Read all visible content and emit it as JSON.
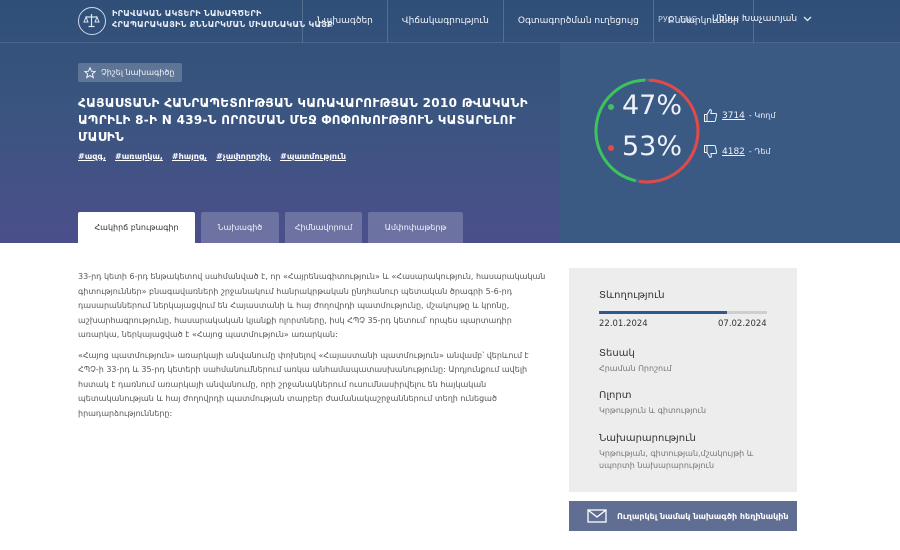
{
  "header": {
    "brand_line1": "ԻՐԱՎԱԿԱՆ ԱԿՏԵՐԻ ՆԱԽԱԳԾԵՐԻ",
    "brand_line2": "ՀՐԱՊԱՐԱԿԱՅԻՆ ՔՆՆԱՐԿՄԱՆ ՄԻԱՍՆԱԿԱՆ ԿԱՅՔ",
    "nav": [
      "Նախագծեր",
      "Վիճակագրություն",
      "Օգտագործման ուղեցույց",
      "Քննարկումներ"
    ],
    "languages": [
      "РУС",
      "ENG"
    ],
    "user_name": "Աննա Խաչատյան"
  },
  "project": {
    "favorite_label": "Չիշել նախագիծը",
    "title": "ՀԱՅԱՍՏԱՆԻ ՀԱՆՐԱՊԵՏՈՒԹՅԱՆ ԿԱՌԱՎԱՐՈՒԹՅԱՆ 2010 ԹՎԱԿԱՆԻ ԱՊՐԻԼԻ 8-Ի N 439-Ն ՈՐՈՇՄԱՆ ՄԵՋ ՓՈՓՈԽՈՒԹՅՈՒՆ ԿԱՏԱՐԵԼՈՒ ՄԱՍԻՆ",
    "tags": [
      "#ազգ,",
      "#առարկա,",
      "#հայոց,",
      "#չափորոշիչ,",
      "#պատմություն"
    ],
    "tabs": [
      "Հակիրճ բնութագիր",
      "Նախագիծ",
      "Հիմնավորում",
      "Ամփոփաթերթ"
    ]
  },
  "votes": {
    "for_percent": "47%",
    "against_percent": "53%",
    "for_fraction": 0.47,
    "for_count": "3714",
    "for_label": "- Կողմ",
    "against_count": "4182",
    "against_label": "- Դեմ",
    "colors": {
      "for": "#3cc45a",
      "against": "#e04a4a"
    }
  },
  "content": {
    "paragraph1": "33-րդ կետի 6-րդ ենթակետով սահմանված է, որ «Հայրենագիտություն» և «Հասարակություն, հասարակական գիտություններ» բնագավառների շրջանակում հանրակրթական ընդհանուր պետական ծրագրի 5-6-րդ դասարաններում ներկայացվում են Հայաստանի և հայ ժողովրդի պատմությունը, մշակույթը և կրոնը, աշխարհագրությունը, հասարակական կյանքի ոլորտները, իսկ ՀՊՉ 35-րդ կետում՝ որպես պարտադիր առարկա, ներկայացված է «Հայոց պատմություն» առարկան:",
    "paragraph2": "«Հայոց պատմություն» առարկայի անվանումը փոխելով «Հայաստանի պատմություն» անվամբ՝ վերևում է ՀՊՉ-ի 33-րդ և 35-րդ կետերի սահմանումներում առկա անհամապատասխանությունը: Արդյունքում ավելի հստակ է դառնում առարկայի անվանումը, որի շրջանակներում ուսումնասիրվելու են հայկական պետականության և հայ ժողովրդի պատմության տարբեր ժամանակաշրջաններում տեղի ունեցած իրադարձությունները:"
  },
  "sidebar": {
    "duration_label": "Տևողություն",
    "progress": 0.76,
    "start_date": "22.01.2024",
    "end_date": "07.02.2024",
    "type_label": "Տեսակ",
    "type_value": "Հրաման Որոշում",
    "field_label": "Ոլորտ",
    "field_value": "Կրթություն և գիտություն",
    "ministry_label": "Նախարարություն",
    "ministry_value": "Կրթության, գիտության,մշակույթի և սպորտի նախարարություն",
    "send_button": "Ուղարկել նամակ նախագծի հեղինակին"
  }
}
